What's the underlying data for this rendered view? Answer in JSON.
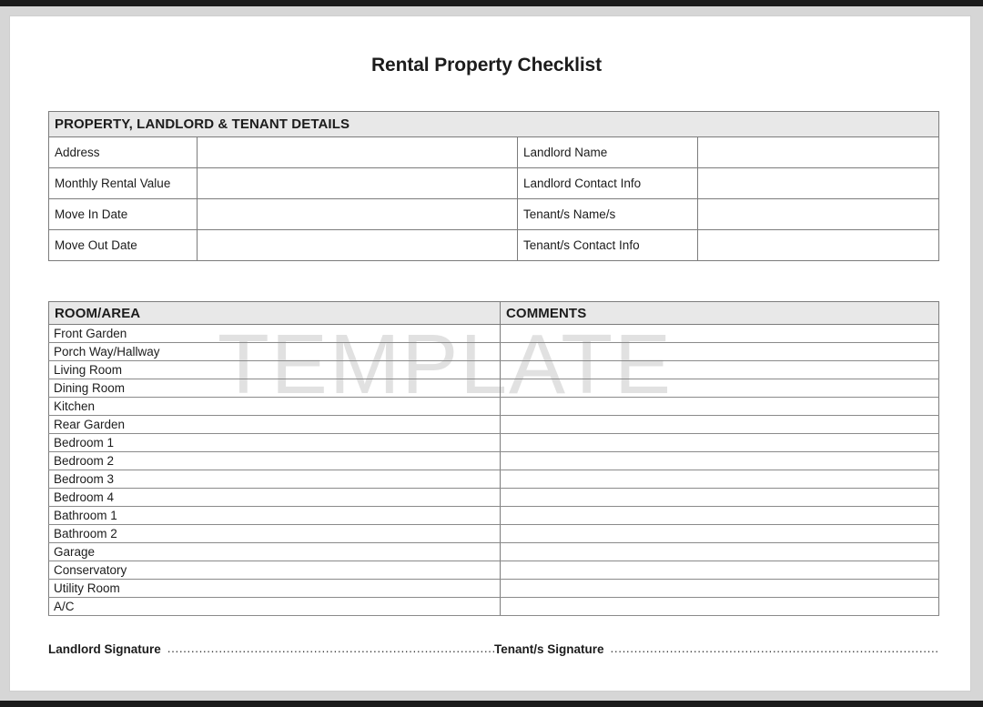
{
  "document": {
    "title": "Rental Property Checklist",
    "watermark": "TEMPLATE"
  },
  "details": {
    "section_header": "PROPERTY, LANDLORD & TENANT DETAILS",
    "rows": [
      {
        "left_label": "Address",
        "left_value": "",
        "right_label": "Landlord Name",
        "right_value": ""
      },
      {
        "left_label": "Monthly Rental Value",
        "left_value": "",
        "right_label": "Landlord Contact Info",
        "right_value": ""
      },
      {
        "left_label": "Move In Date",
        "left_value": "",
        "right_label": "Tenant/s Name/s",
        "right_value": ""
      },
      {
        "left_label": "Move Out Date",
        "left_value": "",
        "right_label": "Tenant/s Contact Info",
        "right_value": ""
      }
    ]
  },
  "rooms": {
    "headers": {
      "room": "ROOM/AREA",
      "comments": "COMMENTS"
    },
    "items": [
      {
        "room": "Front Garden",
        "comment": ""
      },
      {
        "room": "Porch Way/Hallway",
        "comment": ""
      },
      {
        "room": "Living Room",
        "comment": ""
      },
      {
        "room": "Dining Room",
        "comment": ""
      },
      {
        "room": "Kitchen",
        "comment": ""
      },
      {
        "room": "Rear Garden",
        "comment": ""
      },
      {
        "room": "Bedroom 1",
        "comment": ""
      },
      {
        "room": "Bedroom 2",
        "comment": ""
      },
      {
        "room": "Bedroom 3",
        "comment": ""
      },
      {
        "room": "Bedroom 4",
        "comment": ""
      },
      {
        "room": "Bathroom 1",
        "comment": ""
      },
      {
        "room": "Bathroom 2",
        "comment": ""
      },
      {
        "room": "Garage",
        "comment": ""
      },
      {
        "room": "Conservatory",
        "comment": ""
      },
      {
        "room": "Utility Room",
        "comment": ""
      },
      {
        "room": "A/C",
        "comment": ""
      }
    ]
  },
  "signatures": {
    "landlord_label": "Landlord Signature",
    "landlord_line": "..........................................................................................................",
    "tenant_label": "Tenant/s Signature",
    "tenant_line": ".........................................................................................................."
  },
  "colors": {
    "header_fill": "#e8e8e8",
    "border": "#7c7c7c",
    "watermark": "#e1e1e1",
    "text": "#1c1c1c",
    "page": "#ffffff",
    "surround": "#d6d6d6",
    "frame": "#1b1b1b"
  }
}
